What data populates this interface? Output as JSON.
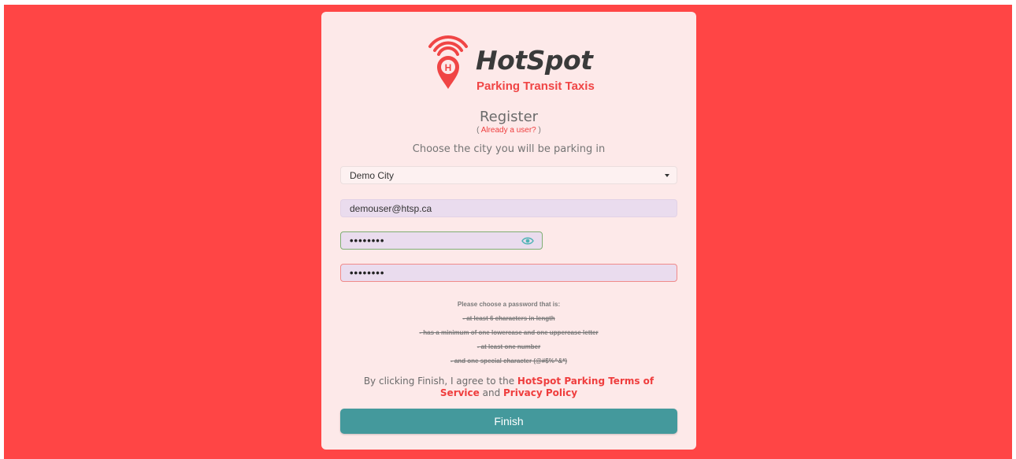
{
  "brand": {
    "name": "HotSpot",
    "tagline": "Parking Transit Taxis",
    "logo_icon": "location-pin-wifi-icon",
    "accent_color": "#ef3d3d",
    "background_color": "#ff4545"
  },
  "form": {
    "title": "Register",
    "login_prefix": "( ",
    "login_link": "Already a user?",
    "login_suffix": " )",
    "subtitle": "Choose the city you will be parking in",
    "city_select": {
      "value": "Demo City",
      "icon": "caret-down-icon"
    },
    "email": {
      "value": "demouser@htsp.ca"
    },
    "password": {
      "value": "••••••••",
      "icon": "eye-icon"
    },
    "confirm_password": {
      "value": "••••••••"
    },
    "requirements": {
      "heading": "Please choose a password that is:",
      "items": [
        "- at least 6 characters in length",
        "- has a minimum of one lowercase and one uppercase letter",
        "- at least one number",
        "- and one special character (@#$%^&*)"
      ]
    },
    "terms": {
      "prefix": "By clicking Finish, I agree to the ",
      "terms_link": "HotSpot Parking Terms of Service",
      "middle": " and ",
      "privacy_link": "Privacy Policy"
    },
    "finish_label": "Finish",
    "finish_color": "#44999c"
  }
}
